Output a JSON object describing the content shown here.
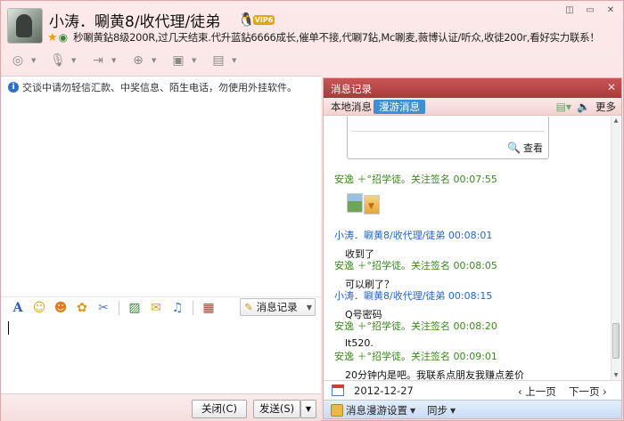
{
  "header": {
    "name": "小涛．唰黄8/收代理/徒弟",
    "vip_label": "VIP6",
    "signature": "秒唰黄鉆8级200R,过几天结束.代升蓝鉆6666成长,催单不接,代唰7鉆,Mc唰麦,薇博认证/听众,收徒200r,看好实力联系！",
    "window_controls": [
      "◫",
      "▭",
      "✕"
    ],
    "tools": [
      "video-icon",
      "voice-icon",
      "transfer-file-icon",
      "add-contact-icon",
      "screen-share-icon",
      "apps-icon"
    ]
  },
  "left": {
    "security_notice": "交谈中请勿轻信汇款、中奖信息、陌生电话，勿使用外挂软件。",
    "format_tools": [
      "font-icon",
      "emoji-icon",
      "cute-emoji-icon",
      "sticker-icon",
      "screenshot-icon",
      "image-icon",
      "gift-icon",
      "music-icon",
      "toolbox-icon"
    ],
    "history_button": "消息记录",
    "close_button": "关闭(C)",
    "send_button": "发送(S)"
  },
  "history": {
    "title": "消息记录",
    "tab_local": "本地消息",
    "tab_roaming": "漫游消息",
    "more_label": "更多",
    "view_label": "查看",
    "messages": [
      {
        "sender": "安逸 ＋°招学徒。关注签名",
        "time": "00:07:55",
        "color": "green",
        "body": ""
      },
      {
        "sender": "小涛．唰黄8/收代理/徒弟",
        "time": "00:08:01",
        "color": "blue",
        "body": "收到了"
      },
      {
        "sender": "安逸 ＋°招学徒。关注签名",
        "time": "00:08:05",
        "color": "green",
        "body": "可以刷了？"
      },
      {
        "sender": "小涛．唰黄8/收代理/徒弟",
        "time": "00:08:15",
        "color": "blue",
        "body": "Q号密码"
      },
      {
        "sender": "安逸 ＋°招学徒。关注签名",
        "time": "00:08:20",
        "color": "green",
        "body": "lt520."
      },
      {
        "sender": "安逸 ＋°招学徒。关注签名",
        "time": "00:09:01",
        "color": "green",
        "body": "20分钟内是吧。我联系点朋友我赚点差价"
      }
    ],
    "date": "2012-12-27",
    "prev_page": "上一页",
    "next_page": "下一页",
    "roaming_settings": "消息漫游设置",
    "sync": "同步"
  },
  "colors": {
    "accent_red": "#b84545",
    "green_sender": "#3a8a1e",
    "blue_sender": "#2366c4",
    "roaming_tab": "#3b8fd6"
  }
}
